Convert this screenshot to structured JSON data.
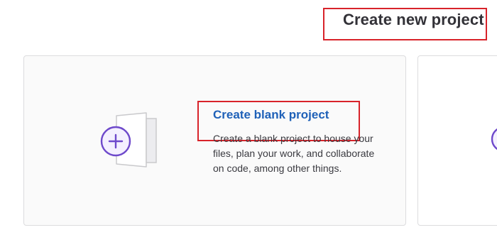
{
  "page": {
    "title": "Create new project"
  },
  "cards": {
    "blank": {
      "heading": "Create blank project",
      "description": "Create a blank project to house your files, plan your work, and collaborate on code, among other things.",
      "icon": "plus-icon"
    },
    "next": {
      "icon": "next-card-icon"
    }
  },
  "colors": {
    "accent": "#1f61b8",
    "icon_purple": "#6e49cb",
    "highlight": "#d8232a"
  }
}
